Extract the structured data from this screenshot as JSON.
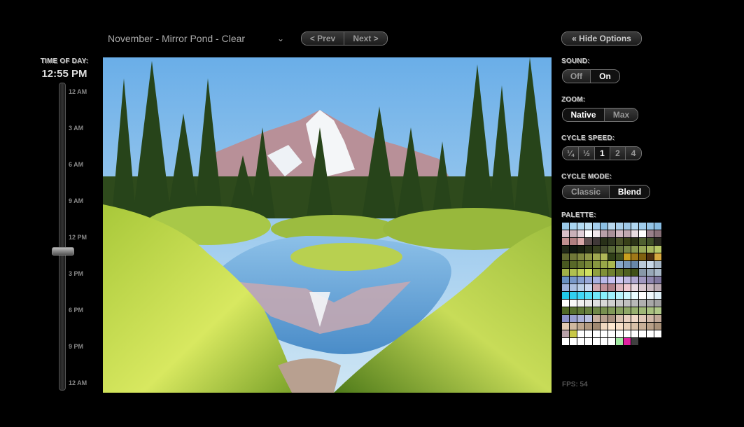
{
  "scene_select": {
    "value": "November - Mirror Pond - Clear"
  },
  "nav": {
    "prev_label": "< Prev",
    "next_label": "Next >",
    "hide_options_label": "« Hide Options"
  },
  "time_of_day": {
    "label": "TIME OF DAY:",
    "value": "12:55 PM",
    "slider_fraction": 0.54,
    "ticks": [
      "12 AM",
      "3 AM",
      "6 AM",
      "9 AM",
      "12 PM",
      "3 PM",
      "6 PM",
      "9 PM",
      "12 AM"
    ]
  },
  "options": {
    "sound": {
      "label": "SOUND:",
      "choices": [
        "Off",
        "On"
      ],
      "selected": "On"
    },
    "zoom": {
      "label": "ZOOM:",
      "choices": [
        "Native",
        "Max"
      ],
      "selected": "Native"
    },
    "cycle_speed": {
      "label": "CYCLE SPEED:",
      "choices": [
        "¼",
        "½",
        "1",
        "2",
        "4"
      ],
      "selected": "1"
    },
    "cycle_mode": {
      "label": "CYCLE MODE:",
      "choices": [
        "Classic",
        "Blend"
      ],
      "selected": "Blend"
    },
    "palette_label": "PALETTE:"
  },
  "fps_text": "FPS: 54",
  "palette_colors": [
    "#9ac8e8",
    "#a8d4f0",
    "#b4dcf4",
    "#c0e2f6",
    "#a4cfee",
    "#8cc0e4",
    "#b8d8ee",
    "#aad0ec",
    "#9ec8e8",
    "#b0d6f0",
    "#a0cdec",
    "#94c4e6",
    "#88bce2",
    "#d8c0c8",
    "#c8b0b8",
    "#e0d0d8",
    "#ffffff",
    "#f0e8ec",
    "#b8a0a8",
    "#a89098",
    "#d0b8c0",
    "#c0a8b0",
    "#e8dce0",
    "#ffffff",
    "#98808a",
    "#887078",
    "#c09090",
    "#b08080",
    "#d8a8a8",
    "#605050",
    "#403838",
    "#283018",
    "#303820",
    "#485028",
    "#384018",
    "#2c3418",
    "#506030",
    "#405028",
    "#2a2a20",
    "#202818",
    "#101810",
    "#182010",
    "#283018",
    "#384020",
    "#485030",
    "#586838",
    "#687840",
    "#788848",
    "#889850",
    "#98a858",
    "#a8b860",
    "#b8c868",
    "#606830",
    "#707838",
    "#808840",
    "#909848",
    "#a0a850",
    "#b0b858",
    "#304018",
    "#405020",
    "#c8a020",
    "#a07818",
    "#806010",
    "#503010",
    "#d8a840",
    "#485820",
    "#586828",
    "#687830",
    "#788838",
    "#889840",
    "#98a848",
    "#a8b850",
    "#88a8c8",
    "#7898b8",
    "#6888a8",
    "#b8c8d8",
    "#c8d8e8",
    "#a8b8c8",
    "#a0b048",
    "#b0c050",
    "#c0d058",
    "#d0e060",
    "#90a040",
    "#809038",
    "#708030",
    "#607028",
    "#506020",
    "#405018",
    "#8898a8",
    "#98a8b8",
    "#a8b8c8",
    "#6890c0",
    "#7898c8",
    "#88a0d0",
    "#98a8d8",
    "#a8b0e0",
    "#b8b8e8",
    "#c8c0f0",
    "#d0c8f0",
    "#c0b8e0",
    "#b0a8d0",
    "#a098c0",
    "#9088b0",
    "#8078a0",
    "#9cb0d8",
    "#acc0e0",
    "#bcd0e8",
    "#ccd8f0",
    "#d0a8b0",
    "#c09098",
    "#b08088",
    "#e0b8c0",
    "#f0c8d0",
    "#e8d8e0",
    "#d8c8d0",
    "#c8b8c0",
    "#b8a8b0",
    "#20c8e8",
    "#30d0f0",
    "#40d8f8",
    "#58e0f8",
    "#70e8fa",
    "#88f0fc",
    "#a0f0fc",
    "#b8f4fc",
    "#d0f8fe",
    "#e8fcff",
    "#ffffff",
    "#f0f8fc",
    "#e0f0f8",
    "#ffffff",
    "#f8f8f8",
    "#f0f0f0",
    "#e8e8e8",
    "#e0e0e0",
    "#d8d8d8",
    "#d0d0d0",
    "#c8c8c8",
    "#c0c0c0",
    "#b8b8b8",
    "#b0b0b0",
    "#a8a8a8",
    "#a0a0a0",
    "#506828",
    "#587030",
    "#607838",
    "#688040",
    "#708848",
    "#789050",
    "#809858",
    "#88a060",
    "#90a868",
    "#98b070",
    "#a0b878",
    "#a8c080",
    "#b0c888",
    "#8a90c8",
    "#9aa0d0",
    "#aab0d8",
    "#bac0e0",
    "#c8b0a0",
    "#b8a090",
    "#a89080",
    "#d8c0b0",
    "#e8d0c0",
    "#f0d8c8",
    "#e0c8b8",
    "#d0b8a8",
    "#c0a898",
    "#e0c8b0",
    "#d0b8a0",
    "#c0a890",
    "#b09880",
    "#a08870",
    "#f0d8c0",
    "#ffe8d0",
    "#f8e0c8",
    "#e8d0b8",
    "#d8c0a8",
    "#c8b098",
    "#b8a088",
    "#a89078",
    "#b8a0a8",
    "#c8c848",
    "#ffffff",
    "#ffffff",
    "#ffffff",
    "#ffffff",
    "#ffffff",
    "#ffffff",
    "#ffffff",
    "#ffffff",
    "#ffffff",
    "#ffffff",
    "#ffffff",
    "#ffffff",
    "#ffffff",
    "#ffffff",
    "#ffffff",
    "#ffffff",
    "#ffffff",
    "#ffffff",
    "#a0e8a0",
    "#e020a0",
    "#404040",
    "#000000"
  ]
}
